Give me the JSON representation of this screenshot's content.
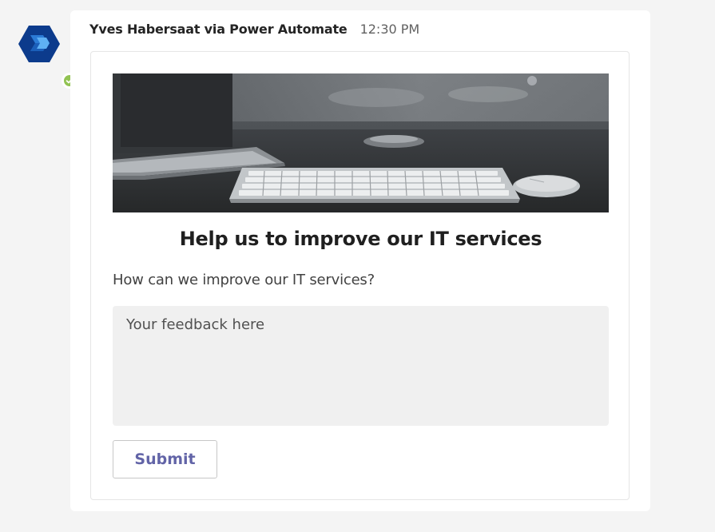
{
  "message": {
    "sender": "Yves Habersaat via Power Automate",
    "timestamp": "12:30 PM",
    "avatar_icon": "power-automate-icon",
    "presence": "available",
    "presence_color": "#92c353"
  },
  "card": {
    "hero_image": "keyboard-desk-photo",
    "title": "Help us to improve our IT services",
    "question": "How can we improve our IT services?",
    "feedback": {
      "value": "",
      "placeholder": "Your feedback here"
    },
    "submit_label": "Submit"
  },
  "colors": {
    "accent": "#6264a7",
    "brand_dark": "#0c2e7a",
    "brand_light": "#2e7bd8"
  }
}
